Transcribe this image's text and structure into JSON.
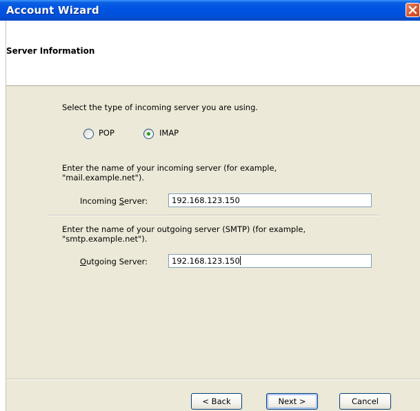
{
  "window": {
    "title": "Account Wizard"
  },
  "header": {
    "title": "Server Information"
  },
  "server_type": {
    "prompt": "Select the type of incoming server you are using.",
    "options": [
      {
        "label": "POP",
        "selected": false
      },
      {
        "label": "IMAP",
        "selected": true
      }
    ]
  },
  "incoming": {
    "instructions_line1": "Enter the name of your incoming server (for example,",
    "instructions_line2": "\"mail.example.net\").",
    "label_pre": "Incoming ",
    "label_accel": "S",
    "label_post": "erver:",
    "value": "192.168.123.150"
  },
  "outgoing": {
    "instructions_line1": "Enter the name of your outgoing server (SMTP) (for example,",
    "instructions_line2": "\"smtp.example.net\").",
    "label_accel": "O",
    "label_post": "utgoing Server:",
    "value": "192.168.123.150"
  },
  "buttons": {
    "back": "< Back",
    "next": "Next >",
    "cancel": "Cancel"
  },
  "colors": {
    "titlebar": "#0054e3",
    "dialog_bg": "#ece9d8",
    "close": "#d65e3b"
  }
}
